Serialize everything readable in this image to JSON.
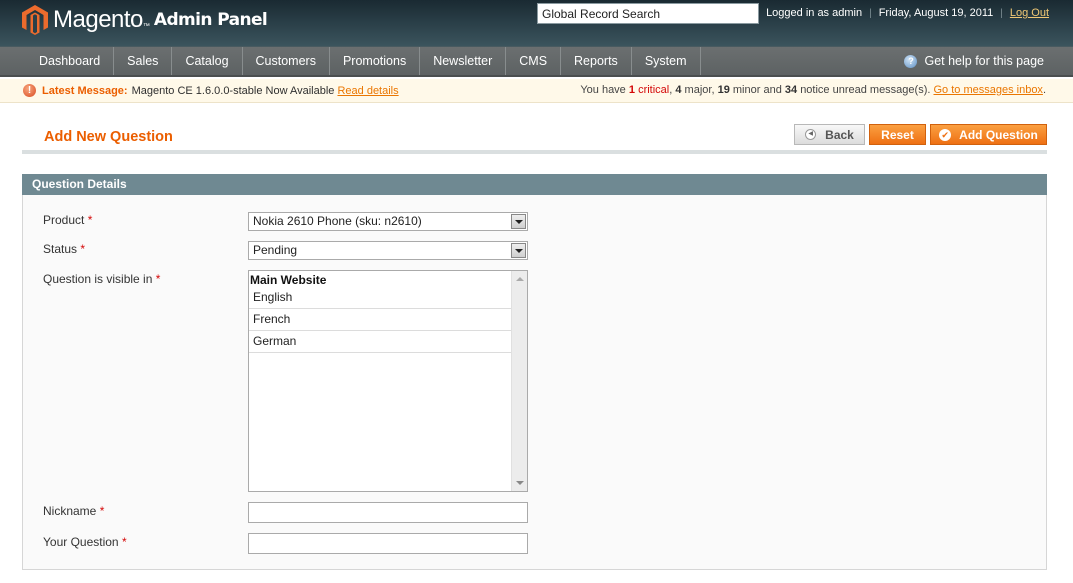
{
  "header": {
    "logo_word": "Magento",
    "logo_tm": "™",
    "logo_sub": "Admin Panel",
    "search_value": "Global Record Search",
    "logged_in": "Logged in as admin",
    "date": "Friday, August 19, 2011",
    "logout": "Log Out",
    "separator": "|"
  },
  "nav": {
    "items": [
      {
        "label": "Dashboard"
      },
      {
        "label": "Sales"
      },
      {
        "label": "Catalog"
      },
      {
        "label": "Customers"
      },
      {
        "label": "Promotions"
      },
      {
        "label": "Newsletter"
      },
      {
        "label": "CMS"
      },
      {
        "label": "Reports"
      },
      {
        "label": "System"
      }
    ],
    "help": "Get help for this page",
    "help_icon": "?"
  },
  "notice": {
    "icon": "!",
    "label": "Latest Message:",
    "message": "Magento CE 1.6.0.0-stable Now Available",
    "read_details": "Read details",
    "summary_prefix": "You have",
    "critical_count": "1",
    "critical_label": "critical",
    "major_count": "4",
    "major_label": "major,",
    "minor_count": "19",
    "minor_label": "minor and",
    "notice_count": "34",
    "notice_label": "notice unread message(s).",
    "inbox_link": "Go to messages inbox",
    "period": "."
  },
  "page": {
    "title": "Add New Question",
    "buttons": {
      "back": "Back",
      "reset": "Reset",
      "add": "Add Question"
    }
  },
  "form": {
    "section_title": "Question Details",
    "required_mark": "*",
    "product": {
      "label": "Product",
      "value": "Nokia 2610 Phone (sku: n2610)"
    },
    "status": {
      "label": "Status",
      "value": "Pending"
    },
    "visible_in": {
      "label": "Question is visible in",
      "group": "Main Website",
      "options": [
        "English",
        "French",
        "German"
      ]
    },
    "nickname": {
      "label": "Nickname",
      "value": ""
    },
    "question": {
      "label": "Your Question",
      "value": ""
    }
  }
}
